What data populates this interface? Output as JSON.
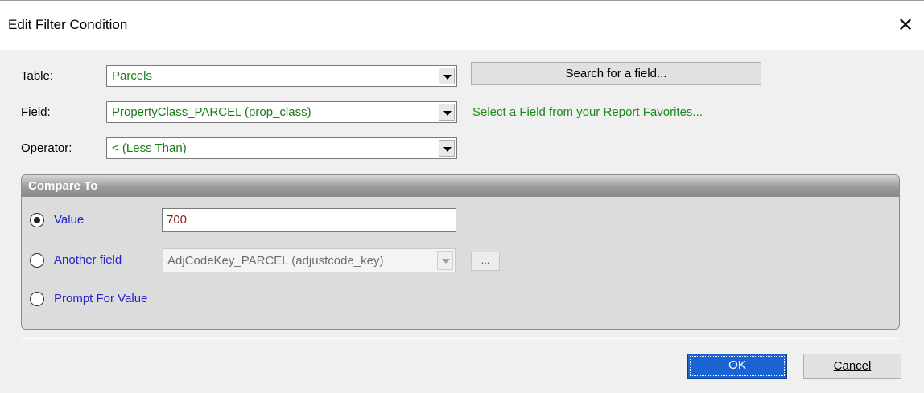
{
  "window": {
    "title": "Edit Filter Condition",
    "close_glyph": "✕"
  },
  "form": {
    "table_label": "Table:",
    "table_value": "Parcels",
    "field_label": "Field:",
    "field_value": "PropertyClass_PARCEL (prop_class)",
    "operator_label": "Operator:",
    "operator_value": "< (Less Than)",
    "search_button": "Search for a field...",
    "favorites_link": "Select a Field from your Report Favorites..."
  },
  "compare": {
    "title": "Compare To",
    "value_label": "Value",
    "value_input": "700",
    "another_field_label": "Another field",
    "another_field_value": "AdjCodeKey_PARCEL (adjustcode_key)",
    "ellipsis_label": "...",
    "prompt_label": "Prompt For Value",
    "selected_option": "value"
  },
  "buttons": {
    "ok": "OK",
    "cancel": "Cancel"
  },
  "colors": {
    "combo_text": "#1a7a1a",
    "radio_label": "#2323c8",
    "value_text": "#8b1a1a",
    "ok_button": "#1b63d2"
  }
}
